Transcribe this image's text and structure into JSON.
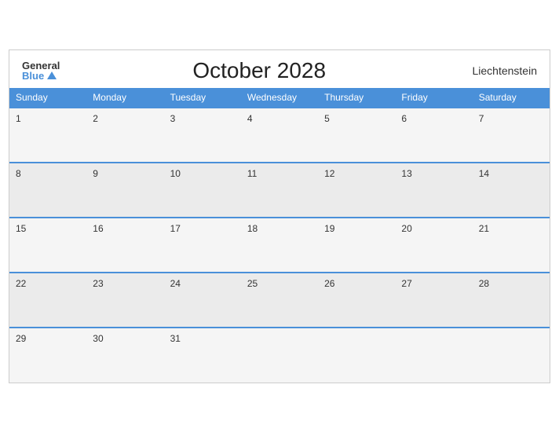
{
  "header": {
    "logo_general": "General",
    "logo_blue": "Blue",
    "title": "October 2028",
    "country": "Liechtenstein"
  },
  "days_of_week": [
    "Sunday",
    "Monday",
    "Tuesday",
    "Wednesday",
    "Thursday",
    "Friday",
    "Saturday"
  ],
  "weeks": [
    [
      1,
      2,
      3,
      4,
      5,
      6,
      7
    ],
    [
      8,
      9,
      10,
      11,
      12,
      13,
      14
    ],
    [
      15,
      16,
      17,
      18,
      19,
      20,
      21
    ],
    [
      22,
      23,
      24,
      25,
      26,
      27,
      28
    ],
    [
      29,
      30,
      31,
      null,
      null,
      null,
      null
    ]
  ]
}
